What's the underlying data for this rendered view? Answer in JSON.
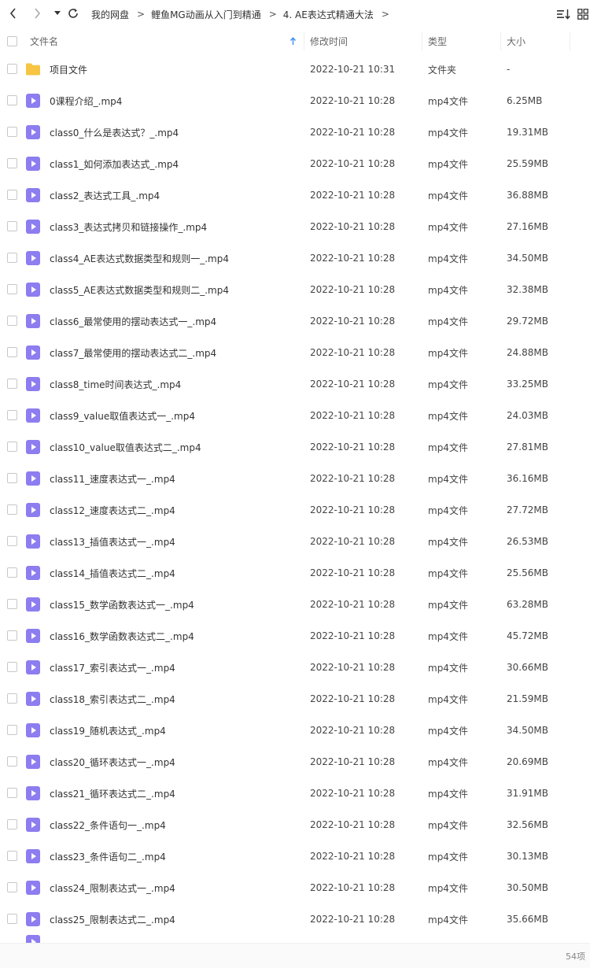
{
  "breadcrumb": {
    "items": [
      "我的网盘",
      "鲤鱼MG动画从入门到精通",
      "4. AE表达式精通大法"
    ]
  },
  "columns": {
    "name": "文件名",
    "modified": "修改时间",
    "type": "类型",
    "size": "大小"
  },
  "files": [
    {
      "name": "项目文件",
      "date": "2022-10-21 10:31",
      "type": "文件夹",
      "size": "-",
      "icon": "folder"
    },
    {
      "name": "0课程介绍_.mp4",
      "date": "2022-10-21 10:28",
      "type": "mp4文件",
      "size": "6.25MB",
      "icon": "video"
    },
    {
      "name": "class0_什么是表达式？_.mp4",
      "date": "2022-10-21 10:28",
      "type": "mp4文件",
      "size": "19.31MB",
      "icon": "video"
    },
    {
      "name": "class1_如何添加表达式_.mp4",
      "date": "2022-10-21 10:28",
      "type": "mp4文件",
      "size": "25.59MB",
      "icon": "video"
    },
    {
      "name": "class2_表达式工具_.mp4",
      "date": "2022-10-21 10:28",
      "type": "mp4文件",
      "size": "36.88MB",
      "icon": "video"
    },
    {
      "name": "class3_表达式拷贝和链接操作_.mp4",
      "date": "2022-10-21 10:28",
      "type": "mp4文件",
      "size": "27.16MB",
      "icon": "video"
    },
    {
      "name": "class4_AE表达式数据类型和规则一_.mp4",
      "date": "2022-10-21 10:28",
      "type": "mp4文件",
      "size": "34.50MB",
      "icon": "video"
    },
    {
      "name": "class5_AE表达式数据类型和规则二_.mp4",
      "date": "2022-10-21 10:28",
      "type": "mp4文件",
      "size": "32.38MB",
      "icon": "video"
    },
    {
      "name": "class6_最常使用的摆动表达式一_.mp4",
      "date": "2022-10-21 10:28",
      "type": "mp4文件",
      "size": "29.72MB",
      "icon": "video"
    },
    {
      "name": "class7_最常使用的摆动表达式二_.mp4",
      "date": "2022-10-21 10:28",
      "type": "mp4文件",
      "size": "24.88MB",
      "icon": "video"
    },
    {
      "name": "class8_time时间表达式_.mp4",
      "date": "2022-10-21 10:28",
      "type": "mp4文件",
      "size": "33.25MB",
      "icon": "video"
    },
    {
      "name": "class9_value取值表达式一_.mp4",
      "date": "2022-10-21 10:28",
      "type": "mp4文件",
      "size": "24.03MB",
      "icon": "video"
    },
    {
      "name": "class10_value取值表达式二_.mp4",
      "date": "2022-10-21 10:28",
      "type": "mp4文件",
      "size": "27.81MB",
      "icon": "video"
    },
    {
      "name": "class11_速度表达式一_.mp4",
      "date": "2022-10-21 10:28",
      "type": "mp4文件",
      "size": "36.16MB",
      "icon": "video"
    },
    {
      "name": "class12_速度表达式二_.mp4",
      "date": "2022-10-21 10:28",
      "type": "mp4文件",
      "size": "27.72MB",
      "icon": "video"
    },
    {
      "name": "class13_插值表达式一_.mp4",
      "date": "2022-10-21 10:28",
      "type": "mp4文件",
      "size": "26.53MB",
      "icon": "video"
    },
    {
      "name": "class14_插值表达式二_.mp4",
      "date": "2022-10-21 10:28",
      "type": "mp4文件",
      "size": "25.56MB",
      "icon": "video"
    },
    {
      "name": "class15_数学函数表达式一_.mp4",
      "date": "2022-10-21 10:28",
      "type": "mp4文件",
      "size": "63.28MB",
      "icon": "video"
    },
    {
      "name": "class16_数学函数表达式二_.mp4",
      "date": "2022-10-21 10:28",
      "type": "mp4文件",
      "size": "45.72MB",
      "icon": "video"
    },
    {
      "name": "class17_索引表达式一_.mp4",
      "date": "2022-10-21 10:28",
      "type": "mp4文件",
      "size": "30.66MB",
      "icon": "video"
    },
    {
      "name": "class18_索引表达式二_.mp4",
      "date": "2022-10-21 10:28",
      "type": "mp4文件",
      "size": "21.59MB",
      "icon": "video"
    },
    {
      "name": "class19_随机表达式_.mp4",
      "date": "2022-10-21 10:28",
      "type": "mp4文件",
      "size": "34.50MB",
      "icon": "video"
    },
    {
      "name": "class20_循环表达式一_.mp4",
      "date": "2022-10-21 10:28",
      "type": "mp4文件",
      "size": "20.69MB",
      "icon": "video"
    },
    {
      "name": "class21_循环表达式二_.mp4",
      "date": "2022-10-21 10:28",
      "type": "mp4文件",
      "size": "31.91MB",
      "icon": "video"
    },
    {
      "name": "class22_条件语句一_.mp4",
      "date": "2022-10-21 10:28",
      "type": "mp4文件",
      "size": "32.56MB",
      "icon": "video"
    },
    {
      "name": "class23_条件语句二_.mp4",
      "date": "2022-10-21 10:28",
      "type": "mp4文件",
      "size": "30.13MB",
      "icon": "video"
    },
    {
      "name": "class24_限制表达式一_.mp4",
      "date": "2022-10-21 10:28",
      "type": "mp4文件",
      "size": "30.50MB",
      "icon": "video"
    },
    {
      "name": "class25_限制表达式二_.mp4",
      "date": "2022-10-21 10:28",
      "type": "mp4文件",
      "size": "35.66MB",
      "icon": "video"
    }
  ],
  "footer": {
    "page_count": "54项"
  },
  "colors": {
    "video_icon": "#8c7df0",
    "folder_icon": "#f7c543",
    "sort_arrow": "#3b8df5"
  }
}
